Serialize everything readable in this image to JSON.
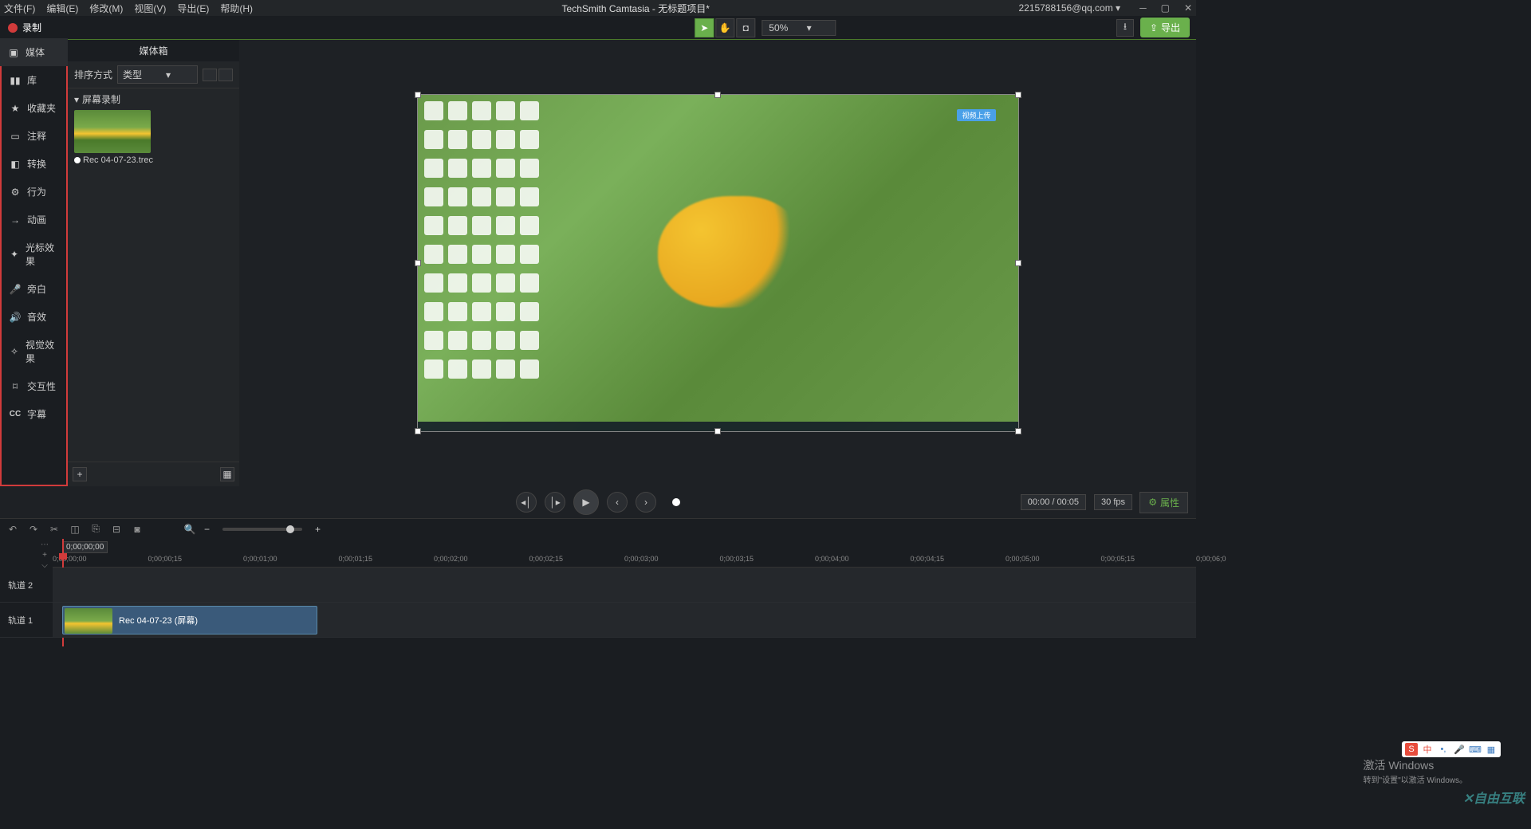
{
  "titlebar": {
    "menus": [
      "文件(F)",
      "编辑(E)",
      "修改(M)",
      "视图(V)",
      "导出(E)",
      "帮助(H)"
    ],
    "title": "TechSmith Camtasia - 无标题项目*",
    "account": "2215788156@qq.com ▾"
  },
  "toolbar": {
    "record": "录制",
    "zoom": "50%",
    "export": "导出"
  },
  "sidebar": {
    "items": [
      {
        "icon": "media",
        "label": "媒体"
      },
      {
        "icon": "library",
        "label": "库"
      },
      {
        "icon": "star",
        "label": "收藏夹"
      },
      {
        "icon": "annot",
        "label": "注释"
      },
      {
        "icon": "trans",
        "label": "转换"
      },
      {
        "icon": "behav",
        "label": "行为"
      },
      {
        "icon": "anim",
        "label": "动画"
      },
      {
        "icon": "cursor",
        "label": "光标效果"
      },
      {
        "icon": "voice",
        "label": "旁白"
      },
      {
        "icon": "audio",
        "label": "音效"
      },
      {
        "icon": "visual",
        "label": "视觉效果"
      },
      {
        "icon": "inter",
        "label": "交互性"
      },
      {
        "icon": "cc",
        "label": "字幕"
      }
    ]
  },
  "panel": {
    "title": "媒体箱",
    "sort_label": "排序方式",
    "sort_value": "类型",
    "group": "屏幕录制",
    "media_name": "Rec 04-07-23.trec"
  },
  "canvas": {
    "badge": "视频上传"
  },
  "playback": {
    "time": "00:00 / 00:05",
    "fps": "30 fps",
    "properties": "属性"
  },
  "timeline": {
    "playhead": "0;00;00;00",
    "ticks": [
      "0;00;00;00",
      "0;00;00;15",
      "0;00;01;00",
      "0;00;01;15",
      "0;00;02;00",
      "0;00;02;15",
      "0;00;03;00",
      "0;00;03;15",
      "0;00;04;00",
      "0;00;04;15",
      "0;00;05;00",
      "0;00;05;15",
      "0;00;06;0"
    ],
    "tracks": [
      "轨道 2",
      "轨道 1"
    ],
    "clip_label": "Rec 04-07-23 (屏幕)"
  },
  "watermark": {
    "title": "激活 Windows",
    "sub": "转到\"设置\"以激活 Windows。"
  },
  "ime": {
    "lang": "中"
  },
  "logo": "自由互联"
}
